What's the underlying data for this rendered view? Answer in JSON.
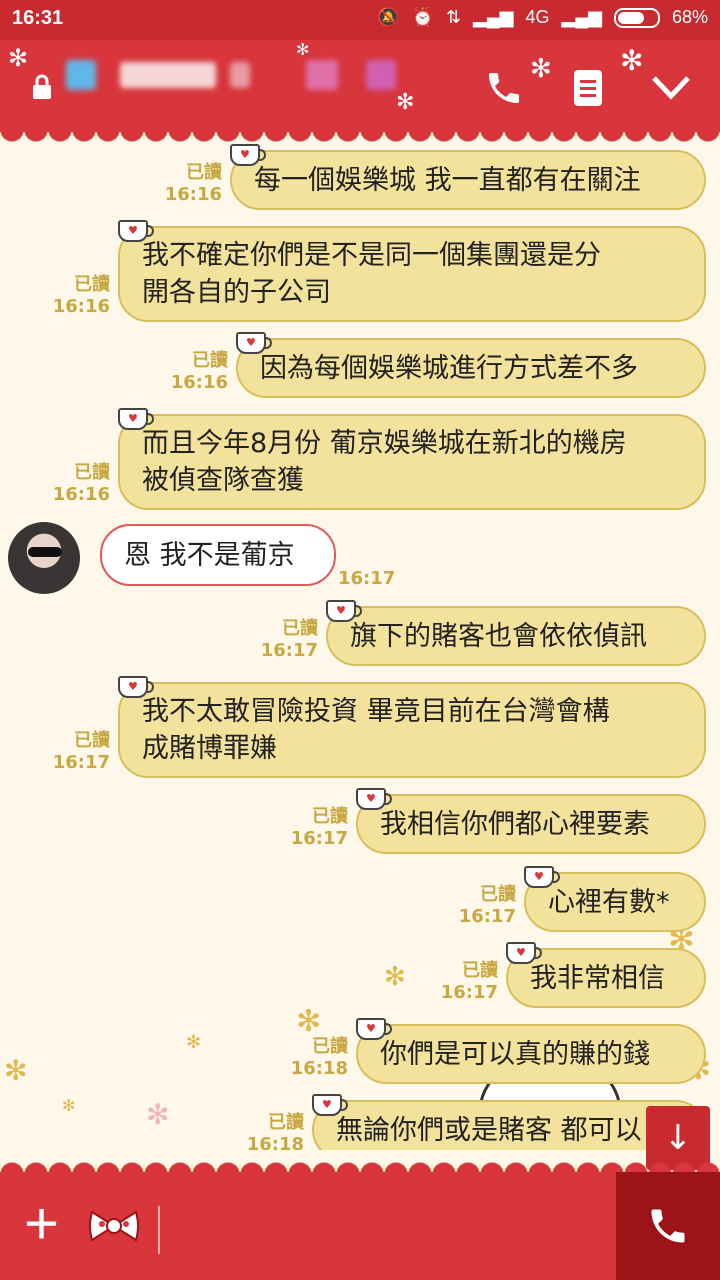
{
  "status": {
    "time": "16:31",
    "network": "4G",
    "battery": "68%",
    "battery_level": 0.68
  },
  "header": {
    "title_hidden": "",
    "icons": [
      "lock-icon",
      "phone-icon",
      "notes-icon",
      "chevron-down-icon"
    ]
  },
  "messages": [
    {
      "dir": "out",
      "read": "已讀",
      "time": "16:16",
      "text": "每一個娛樂城 我一直都有在關注"
    },
    {
      "dir": "out",
      "read": "已讀",
      "time": "16:16",
      "lines": [
        "我不確定你們是不是同一個集團還是分",
        "開各自的子公司"
      ]
    },
    {
      "dir": "out",
      "read": "已讀",
      "time": "16:16",
      "text": "因為每個娛樂城進行方式差不多"
    },
    {
      "dir": "out",
      "read": "已讀",
      "time": "16:16",
      "lines": [
        "而且今年8月份 葡京娛樂城在新北的機房",
        "被偵查隊查獲"
      ]
    },
    {
      "dir": "in",
      "time": "16:17",
      "text": "恩  我不是葡京"
    },
    {
      "dir": "out",
      "read": "已讀",
      "time": "16:17",
      "text": "旗下的賭客也會依依偵訊"
    },
    {
      "dir": "out",
      "read": "已讀",
      "time": "16:17",
      "lines": [
        "我不太敢冒險投資  畢竟目前在台灣會構",
        "成賭博罪嫌"
      ]
    },
    {
      "dir": "out",
      "read": "已讀",
      "time": "16:17",
      "text": "我相信你們都心裡要素"
    },
    {
      "dir": "out",
      "read": "已讀",
      "time": "16:17",
      "text": "心裡有數*"
    },
    {
      "dir": "out",
      "read": "已讀",
      "time": "16:17",
      "text": "我非常相信"
    },
    {
      "dir": "out",
      "read": "已讀",
      "time": "16:18",
      "text": "你們是可以真的賺的錢"
    },
    {
      "dir": "out",
      "read": "已讀",
      "time": "16:18",
      "text": "無論你們或是賭客  都可以"
    }
  ],
  "scroll_button": "↓",
  "bottom": {
    "plus": "+"
  }
}
